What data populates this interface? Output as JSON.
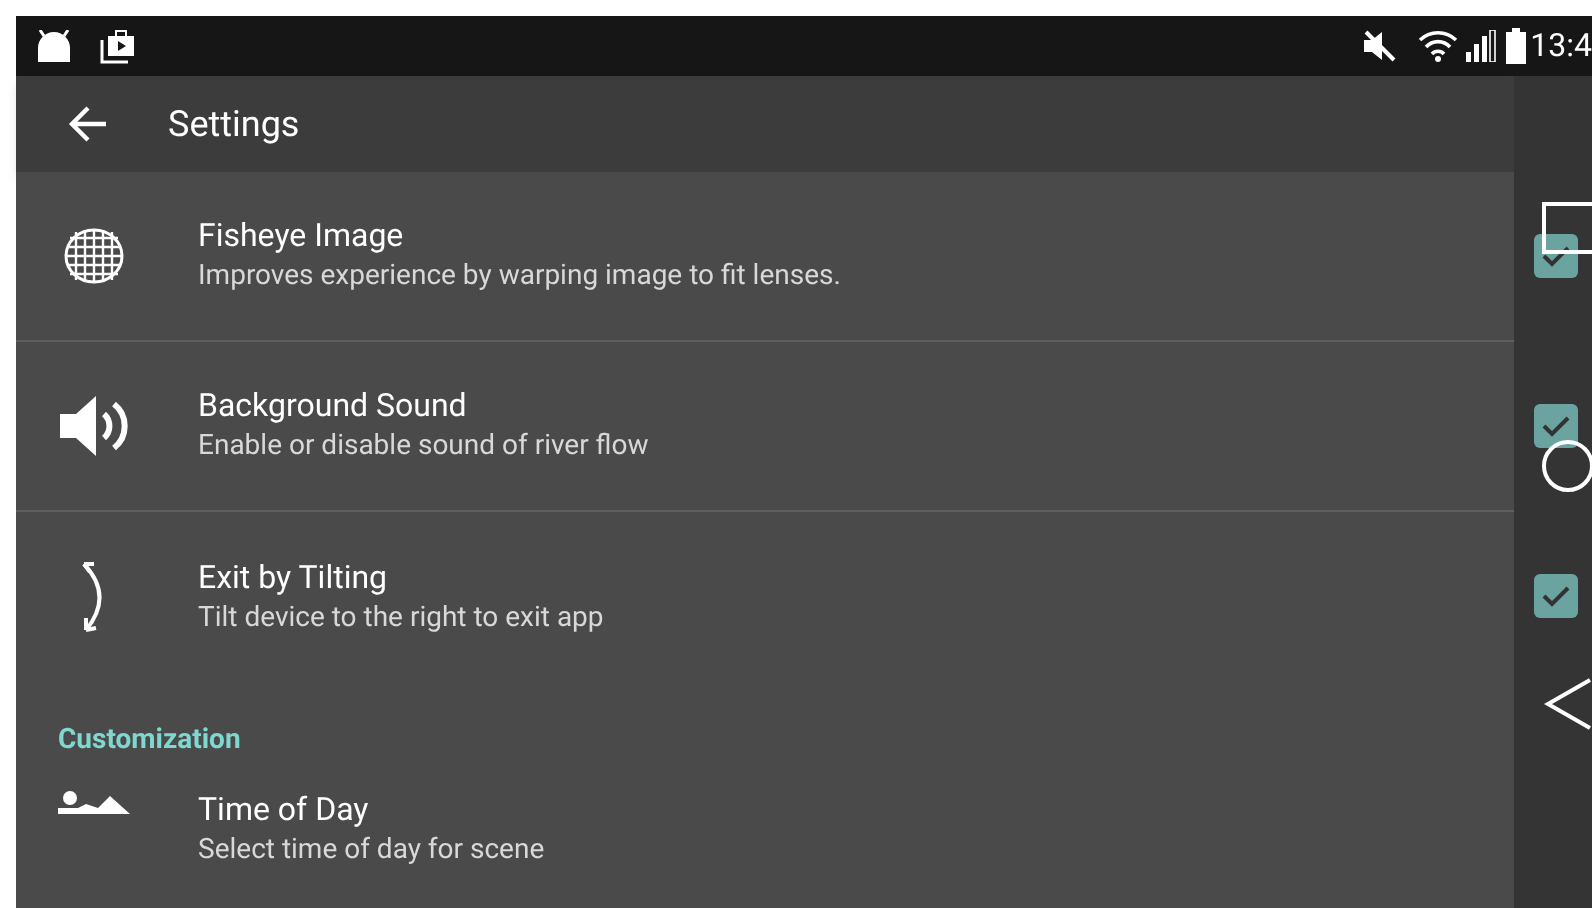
{
  "status_bar": {
    "time": "13:4"
  },
  "toolbar": {
    "title": "Settings"
  },
  "sections": [
    {
      "items": [
        {
          "title": "Fisheye Image",
          "summary": "Improves experience by warping image to fit lenses.",
          "checked": true
        },
        {
          "title": "Background Sound",
          "summary": "Enable or disable sound of river flow",
          "checked": true
        },
        {
          "title": "Exit by Tilting",
          "summary": "Tilt device to the right to exit app",
          "checked": true
        }
      ]
    },
    {
      "header": "Customization",
      "items": [
        {
          "title": "Time of Day",
          "summary": "Select time of day for scene"
        }
      ]
    }
  ]
}
